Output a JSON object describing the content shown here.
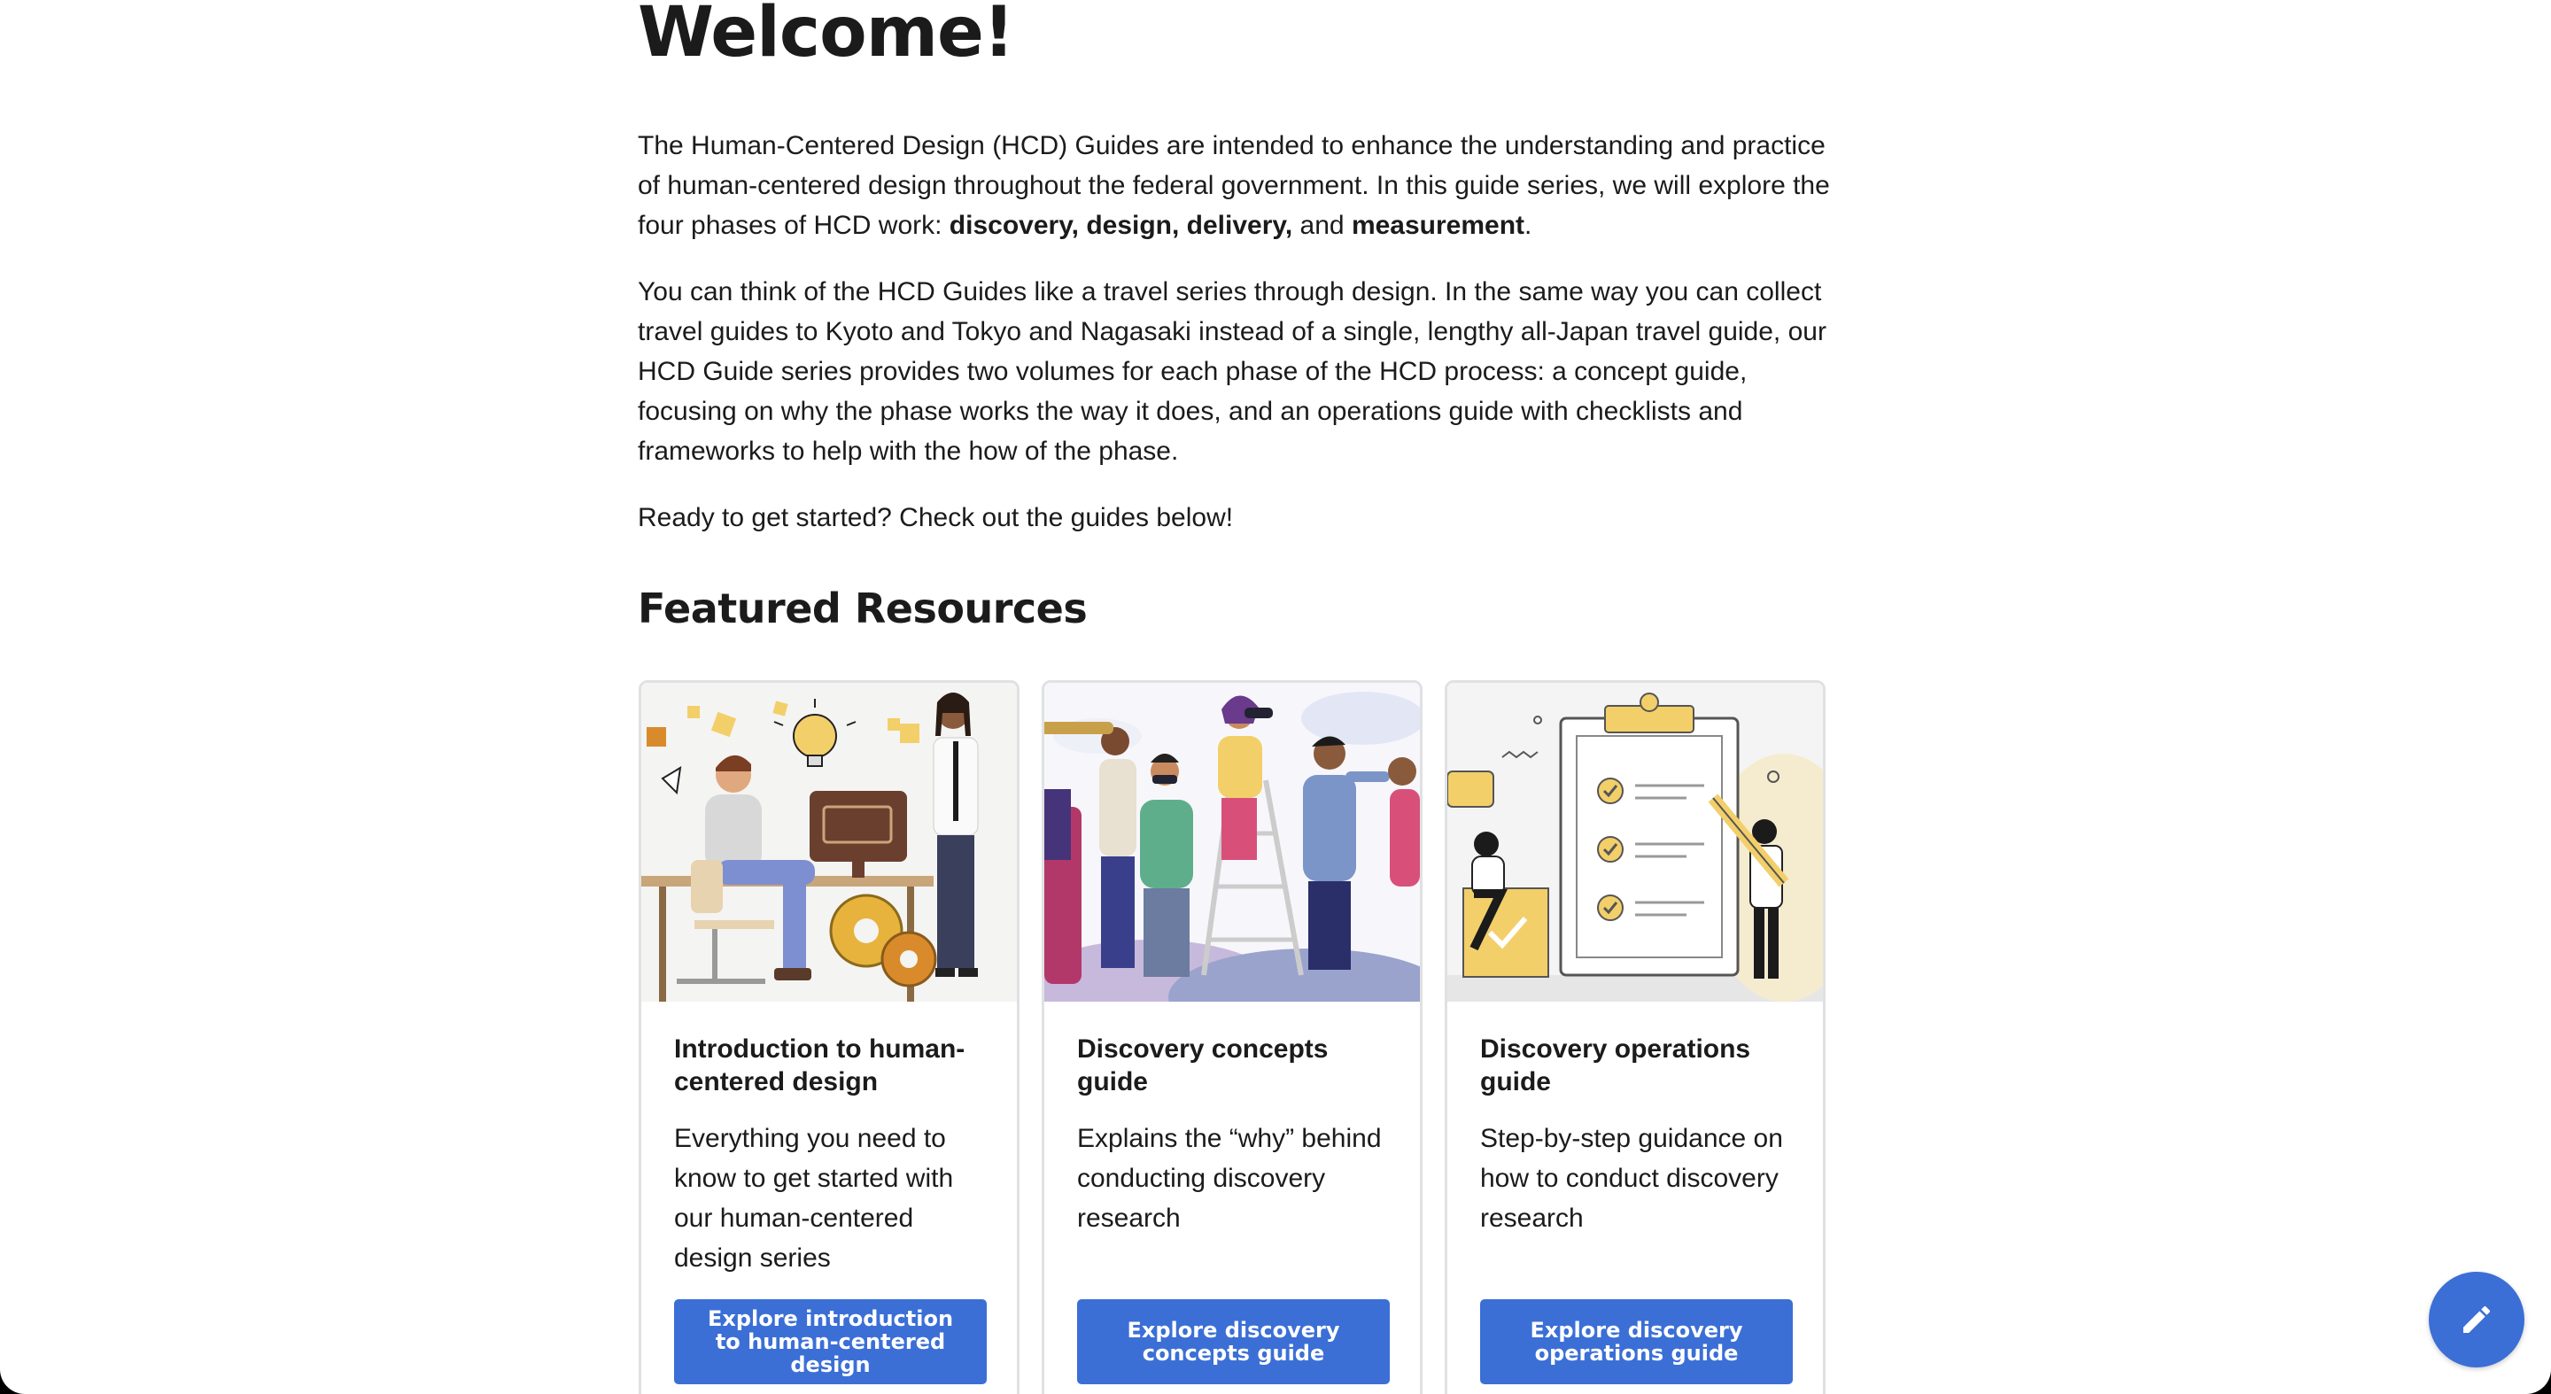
{
  "welcome": {
    "title": "Welcome!"
  },
  "intro": {
    "p1_start": "The Human-Centered Design (HCD) Guides are intended to enhance the understanding and practice of human-centered design throughout the federal government. In this guide series, we will explore the four phases of HCD work: ",
    "p1_bold_phases": "discovery, design, delivery,",
    "p1_and": " and ",
    "p1_bold_measurement": "measurement",
    "p1_end": ".",
    "p2": "You can think of the HCD Guides like a travel series through design. In the same way you can collect travel guides to Kyoto and Tokyo and Nagasaki instead of a single, lengthy all-Japan travel guide, our HCD Guide series provides two volumes for each phase of the HCD process: a concept guide, focusing on why the phase works the way it does, and an operations guide with checklists and frameworks to help with the how of the phase.",
    "p3": "Ready to get started? Check out the guides below!"
  },
  "featured": {
    "heading": "Featured Resources",
    "cards": [
      {
        "title": "Introduction to human-centered design",
        "description": "Everything you need to know to get started with our human-centered design series",
        "button": "Explore introduction to human-centered design"
      },
      {
        "title": "Discovery concepts guide",
        "description": "Explains the “why” behind conducting discovery research",
        "button": "Explore discovery concepts guide"
      },
      {
        "title": "Discovery operations guide",
        "description": "Step-by-step guidance on how to conduct discovery research",
        "button": "Explore discovery operations guide"
      }
    ]
  },
  "fab": {
    "icon": "pencil-icon"
  },
  "colors": {
    "primary_button": "#3b6fd6",
    "text": "#1b1b1b",
    "card_border": "#dfe1e2",
    "illustration_yellow": "#f3cf6a"
  }
}
